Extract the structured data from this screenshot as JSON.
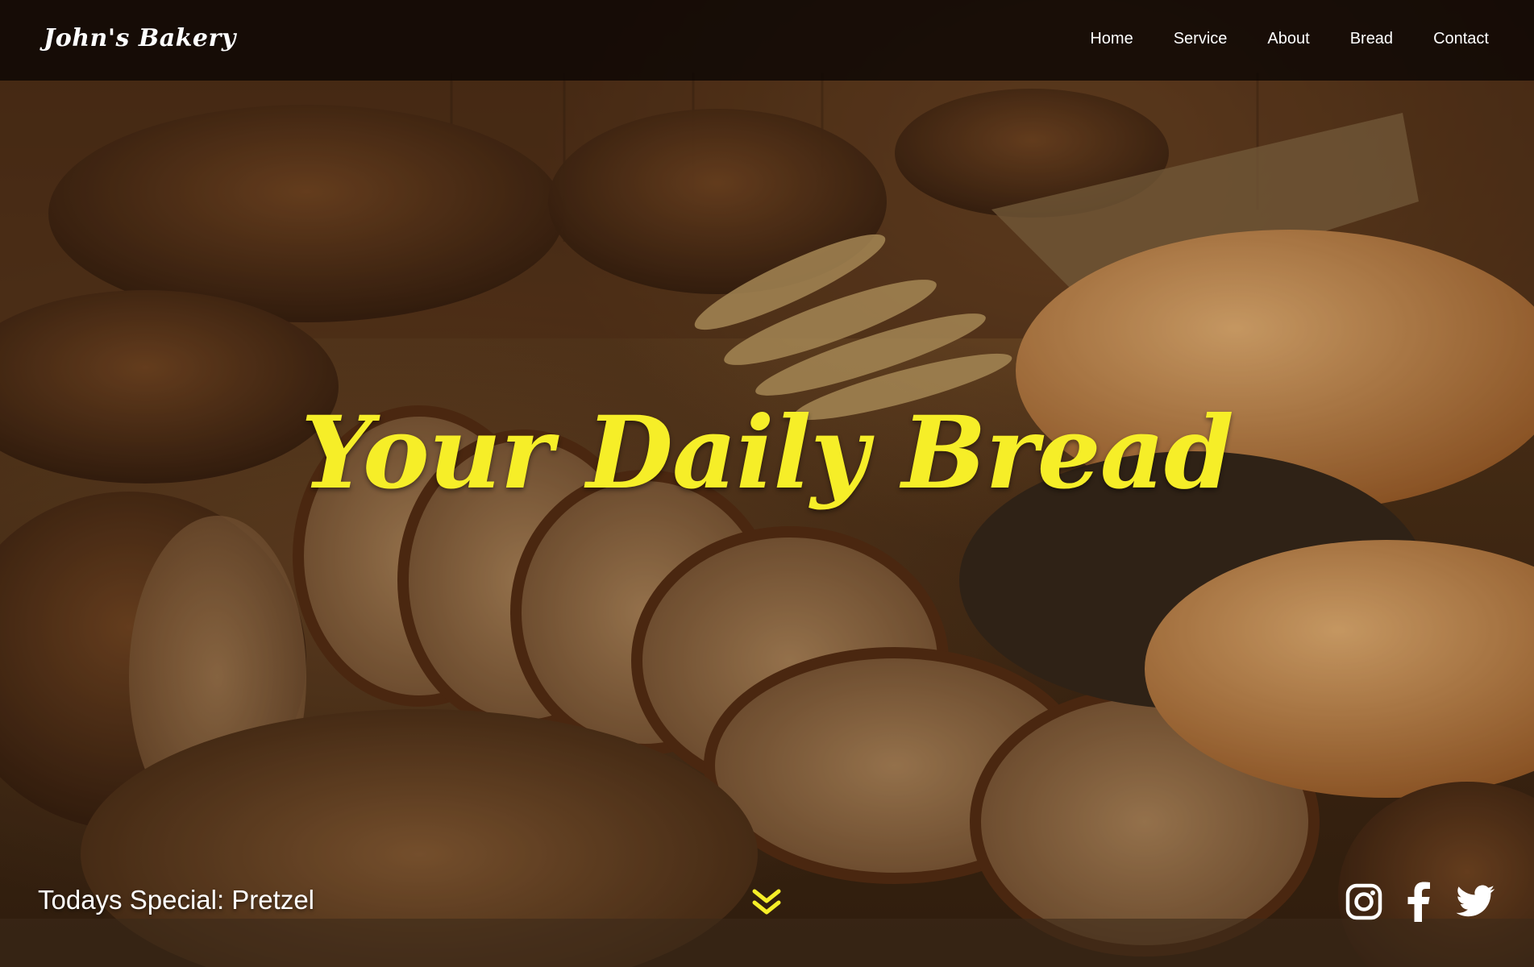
{
  "header": {
    "logo": "John's Bakery",
    "nav": [
      "Home",
      "Service",
      "About",
      "Bread",
      "Contact"
    ]
  },
  "hero": {
    "headline": "Your Daily Bread",
    "special": "Todays Special: Pretzel"
  },
  "icons": {
    "scroll": "chevron-double-down-icon",
    "social": [
      "instagram-icon",
      "facebook-icon",
      "twitter-icon"
    ]
  },
  "colors": {
    "accent": "#f6ee28",
    "header_bg": "#0c0604",
    "text": "#ffffff"
  }
}
